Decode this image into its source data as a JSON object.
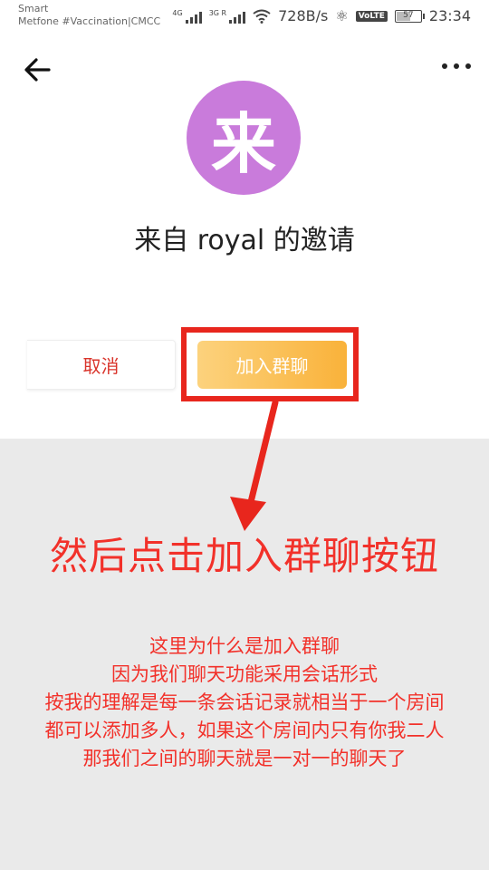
{
  "status_bar": {
    "carrier_line1": "Smart",
    "carrier_line2": "Metfone #Vaccination|CMCC",
    "signal1_tag": "4G",
    "signal2_tag": "3G R",
    "speed": "728B/s",
    "volte": "VoLTE",
    "battery": "57",
    "time": "23:34"
  },
  "header": {
    "back_icon": "arrow-left-icon",
    "more_icon": "more-dots-icon"
  },
  "invite": {
    "avatar_char": "来",
    "avatar_color": "#c97bdb",
    "title": "来自 royal 的邀请"
  },
  "actions": {
    "cancel_label": "取消",
    "join_label": "加入群聊"
  },
  "annotation": {
    "headline": "然后点击加入群聊按钮",
    "lines": [
      "这里为什么是加入群聊",
      "因为我们聊天功能采用会话形式",
      "按我的理解是每一条会话记录就相当于一个房间",
      "都可以添加多人，如果这个房间内只有你我二人",
      "那我们之间的聊天就是一对一的聊天了"
    ],
    "color": "#f2312a"
  }
}
